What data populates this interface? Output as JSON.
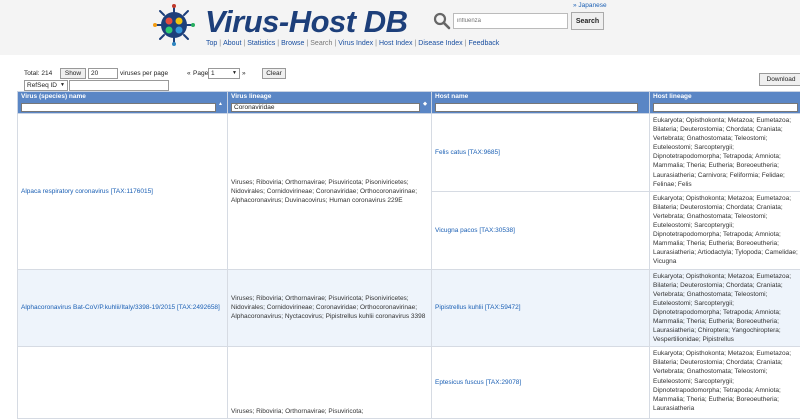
{
  "header": {
    "logo_text": "Virus-Host DB",
    "language_link": "» Japanese",
    "search": {
      "value": "",
      "placeholder": "influenza",
      "button_label": "Search"
    },
    "nav": [
      {
        "label": "Top"
      },
      {
        "label": "About"
      },
      {
        "label": "Statistics"
      },
      {
        "label": "Browse"
      },
      {
        "label": "Search"
      },
      {
        "label": "Virus Index"
      },
      {
        "label": "Host Index"
      },
      {
        "label": "Disease Index"
      },
      {
        "label": "Feedback"
      }
    ]
  },
  "controls": {
    "total_label": "Total: 214",
    "show_label": "Show",
    "per_page_value": "20",
    "per_page_text": "viruses per page",
    "page_prev": "«",
    "page_label": "Page",
    "page_value": "1",
    "page_next": "»",
    "clear_label": "Clear",
    "id_select": "RefSeq ID",
    "id_value": "",
    "download_label": "Download"
  },
  "table": {
    "columns": [
      {
        "label": "Virus (species) name",
        "filter": "",
        "sort": "▲"
      },
      {
        "label": "Virus lineage",
        "filter": "Coronaviridae",
        "sort": "◆"
      },
      {
        "label": "Host name",
        "filter": ""
      },
      {
        "label": "Host lineage",
        "filter": ""
      }
    ],
    "rows": [
      {
        "virus": "Alpaca respiratory coronavirus [TAX:1176015]",
        "lineage": "Viruses; Riboviria; Orthornavirae; Pisuviricota; Pisoniviricetes; Nidovirales; Cornidovirineae; Coronaviridae; Orthocoronavirinae; Alphacoronavirus; Duvinacovirus; Human coronavirus 229E",
        "hosts": [
          {
            "name": "Felis catus [TAX:9685]",
            "lineage": "Eukaryota; Opisthokonta; Metazoa; Eumetazoa; Bilateria; Deuterostomia; Chordata; Craniata; Vertebrata; Gnathostomata; Teleostomi; Euteleostomi; Sarcopterygii; Dipnotetrapodomorpha; Tetrapoda; Amniota; Mammalia; Theria; Eutheria; Boreoeutheria; Laurasiatheria; Carnivora; Feliformia; Felidae; Felinae; Felis"
          },
          {
            "name": "Vicugna pacos [TAX:30538]",
            "lineage": "Eukaryota; Opisthokonta; Metazoa; Eumetazoa; Bilateria; Deuterostomia; Chordata; Craniata; Vertebrata; Gnathostomata; Teleostomi; Euteleostomi; Sarcopterygii; Dipnotetrapodomorpha; Tetrapoda; Amniota; Mammalia; Theria; Eutheria; Boreoeutheria; Laurasiatheria; Artiodactyla; Tylopoda; Camelidae; Vicugna"
          }
        ]
      },
      {
        "virus": "Alphacoronavirus Bat-CoV/P.kuhlii/Italy/3398-19/2015 [TAX:2492658]",
        "lineage": "Viruses; Riboviria; Orthornavirae; Pisuviricota; Pisoniviricetes; Nidovirales; Cornidovirineae; Coronaviridae; Orthocoronavirinae; Alphacoronavirus; Nyctacovirus; Pipistrellus kuhlii coronavirus 3398",
        "hosts": [
          {
            "name": "Pipistrellus kuhlii [TAX:59472]",
            "lineage": "Eukaryota; Opisthokonta; Metazoa; Eumetazoa; Bilateria; Deuterostomia; Chordata; Craniata; Vertebrata; Gnathostomata; Teleostomi; Euteleostomi; Sarcopterygii; Dipnotetrapodomorpha; Tetrapoda; Amniota; Mammalia; Theria; Eutheria; Boreoeutheria; Laurasiatheria; Chiroptera; Yangochiroptera; Vespertilionidae; Pipistrellus"
          }
        ]
      },
      {
        "virus": "",
        "lineage": "Viruses; Riboviria; Orthornavirae; Pisuviricota;",
        "hosts": [
          {
            "name": "Eptesicus fuscus [TAX:29078]",
            "lineage": "Eukaryota; Opisthokonta; Metazoa; Eumetazoa; Bilateria; Deuterostomia; Chordata; Craniata; Vertebrata; Gnathostomata; Teleostomi; Euteleostomi; Sarcopterygii; Dipnotetrapodomorpha; Tetrapoda; Amniota; Mammalia; Theria; Eutheria; Boreoeutheria; Laurasiatheria"
          }
        ]
      }
    ]
  }
}
